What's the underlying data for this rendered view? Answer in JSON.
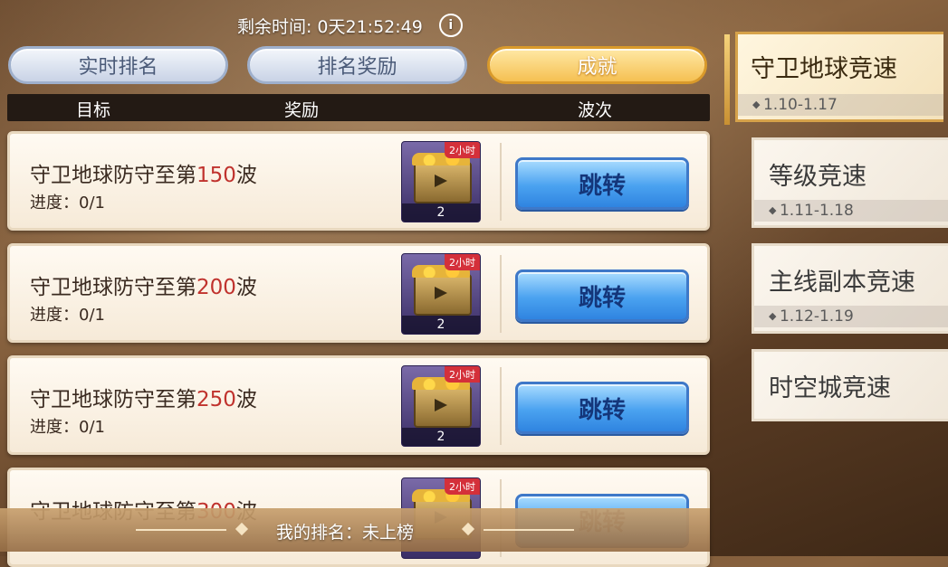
{
  "timer": {
    "label": "剩余时间:",
    "value": "0天21:52:49",
    "info_icon": "info-icon"
  },
  "tabs": [
    {
      "label": "实时排名",
      "active": false
    },
    {
      "label": "排名奖励",
      "active": false
    },
    {
      "label": "成就",
      "active": true
    }
  ],
  "columns": {
    "target": "目标",
    "reward": "奖励",
    "wave": "波次"
  },
  "rows": [
    {
      "prefix": "守卫地球防守至第",
      "num": "150",
      "suffix": "波",
      "progress": "进度：0/1",
      "reward_badge": "2小时",
      "reward_count": "2",
      "button": "跳转"
    },
    {
      "prefix": "守卫地球防守至第",
      "num": "200",
      "suffix": "波",
      "progress": "进度：0/1",
      "reward_badge": "2小时",
      "reward_count": "2",
      "button": "跳转"
    },
    {
      "prefix": "守卫地球防守至第",
      "num": "250",
      "suffix": "波",
      "progress": "进度：0/1",
      "reward_badge": "2小时",
      "reward_count": "2",
      "button": "跳转"
    },
    {
      "prefix": "守卫地球防守至第",
      "num": "300",
      "suffix": "波",
      "progress": "",
      "reward_badge": "2小时",
      "reward_count": "",
      "button": "跳转"
    }
  ],
  "my_rank": "我的排名：未上榜",
  "events": [
    {
      "name": "守卫地球竞速",
      "dates": "1.10-1.17",
      "active": true
    },
    {
      "name": "等级竞速",
      "dates": "1.11-1.18",
      "active": false
    },
    {
      "name": "主线副本竞速",
      "dates": "1.12-1.19",
      "active": false
    },
    {
      "name": "时空城竞速",
      "dates": "",
      "active": false
    }
  ]
}
